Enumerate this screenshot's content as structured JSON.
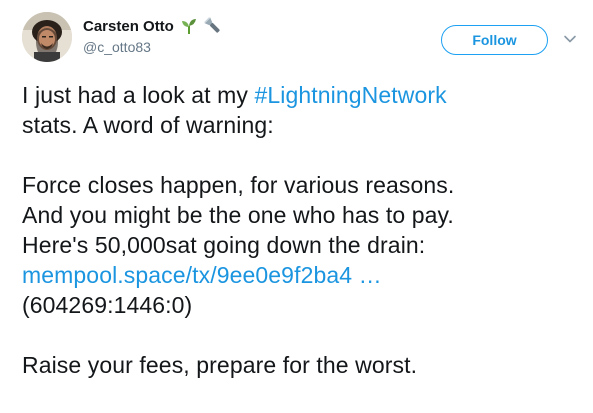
{
  "author": {
    "display_name": "Carsten Otto",
    "handle": "@c_otto83",
    "name_icons": [
      "seedling-icon",
      "flashlight-icon"
    ]
  },
  "actions": {
    "follow_label": "Follow",
    "caret_icon": "chevron-down-icon"
  },
  "tweet": {
    "line1_prefix": "I just had a look at my ",
    "line1_hashtag": "#LightningNetwork",
    "line2": "stats. A word of warning:",
    "line3": "Force closes happen, for various reasons.",
    "line4": "And you might be the one who has to pay.",
    "line5": "Here's 50,000sat going down the drain:",
    "link_text": "mempool.space/tx/9ee0e9f2ba4",
    "link_ellipsis": " …",
    "line7": "(604269:1446:0)",
    "line8": "Raise your fees, prepare for the worst."
  },
  "colors": {
    "link": "#1b95e0",
    "text": "#14171a",
    "muted": "#657786",
    "follow_border": "#1da1f2"
  }
}
